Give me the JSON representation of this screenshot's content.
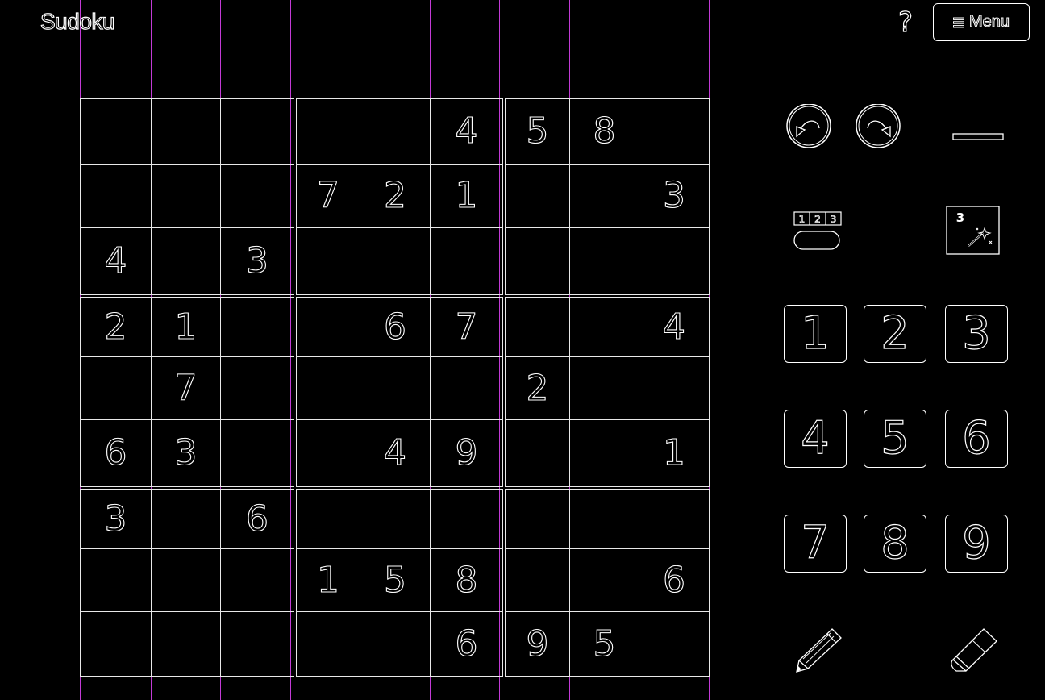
{
  "app": {
    "title": "Sudoku"
  },
  "header": {
    "help_label": "?",
    "menu_label": "Menu",
    "menu_icon": "hamburger-icon"
  },
  "board": {
    "rows": [
      [
        "",
        "",
        "",
        "",
        "",
        "4",
        "5",
        "8",
        ""
      ],
      [
        "",
        "",
        "",
        "7",
        "2",
        "1",
        "",
        "",
        "3"
      ],
      [
        "4",
        "",
        "3",
        "",
        "",
        "",
        "",
        "",
        ""
      ],
      [
        "2",
        "1",
        "",
        "",
        "6",
        "7",
        "",
        "",
        "4"
      ],
      [
        "",
        "7",
        "",
        "",
        "",
        "",
        "2",
        "",
        ""
      ],
      [
        "6",
        "3",
        "",
        "",
        "4",
        "9",
        "",
        "",
        "1"
      ],
      [
        "3",
        "",
        "6",
        "",
        "",
        "",
        "",
        "",
        ""
      ],
      [
        "",
        "",
        "",
        "1",
        "5",
        "8",
        "",
        "",
        "6"
      ],
      [
        "",
        "",
        "",
        "",
        "",
        "6",
        "9",
        "5",
        ""
      ]
    ]
  },
  "tools": {
    "undo_icon": "undo-icon",
    "redo_icon": "redo-icon",
    "minimize_icon": "minimize-icon",
    "notes_icon": "notes-mode-icon",
    "notes_label": "123",
    "hint_icon": "hint-magic-wand-icon",
    "hint_label": "3",
    "pencil_icon": "pencil-icon",
    "eraser_icon": "eraser-icon"
  },
  "keypad": {
    "keys": [
      "1",
      "2",
      "3",
      "4",
      "5",
      "6",
      "7",
      "8",
      "9"
    ]
  },
  "colors": {
    "background": "#000000",
    "outline": "#ffffff",
    "guide": "#c33bd6"
  }
}
